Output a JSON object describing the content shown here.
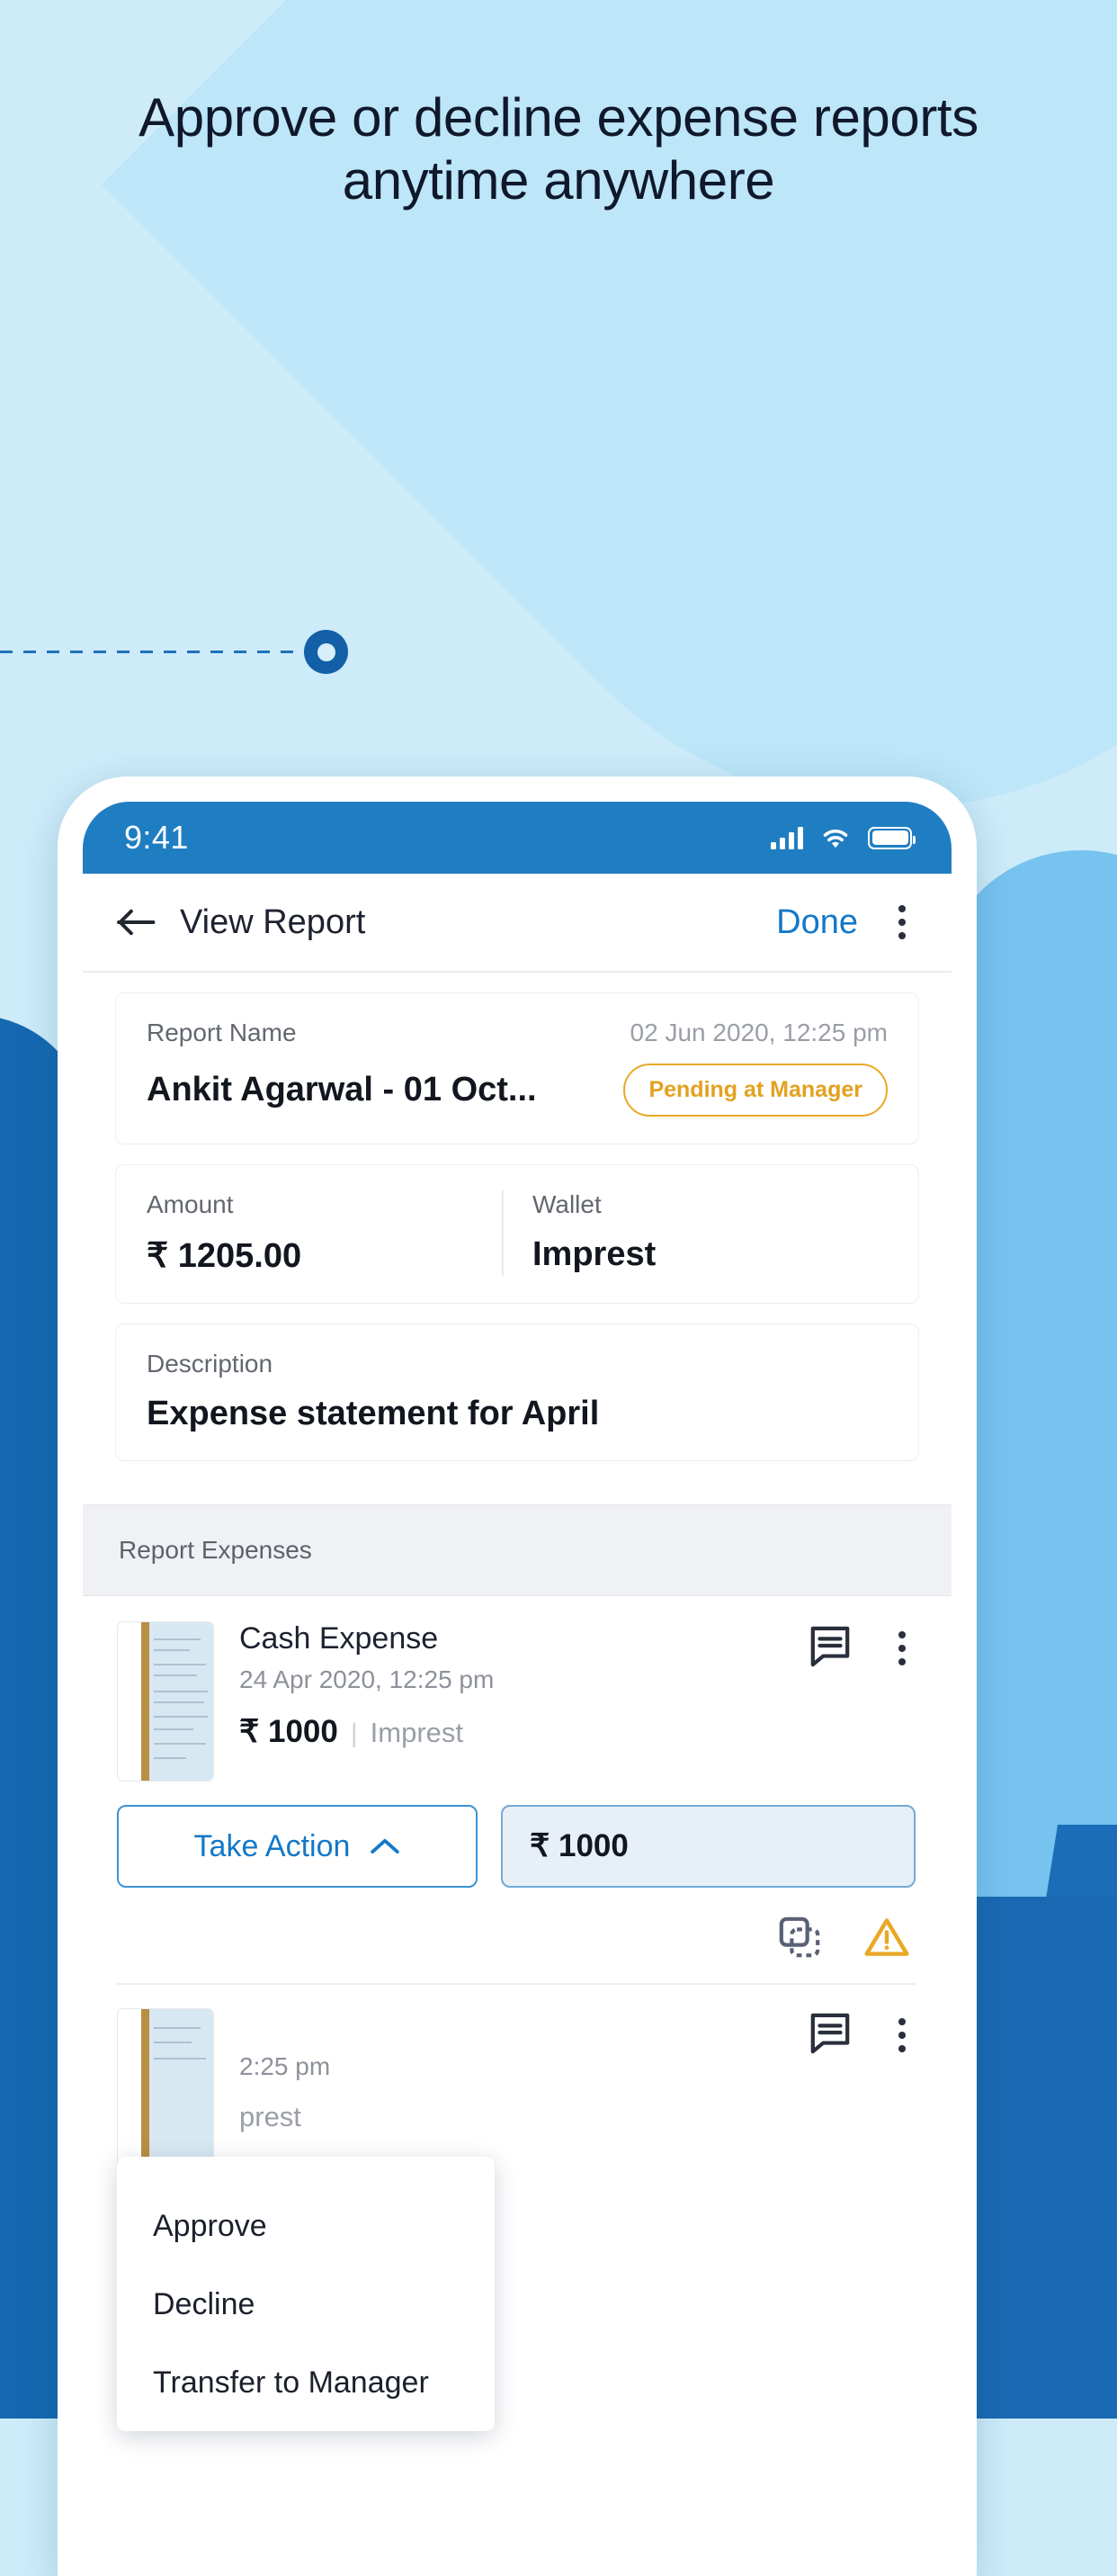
{
  "promo": {
    "headline": "Approve or decline expense reports anytime anywhere",
    "accent_color": "#1568b0",
    "background_color": "#cdebf9"
  },
  "phone": {
    "status_bar": {
      "time": "9:41",
      "icons": [
        "signal-icon",
        "wifi-icon",
        "battery-icon"
      ],
      "background_color": "#1f7ec2"
    },
    "app_bar": {
      "back_icon": "arrow-left-icon",
      "title": "View Report",
      "done_label": "Done",
      "overflow_icon": "kebab-menu-icon",
      "link_color": "#1378c8"
    },
    "report": {
      "name_label": "Report Name",
      "timestamp": "02 Jun 2020, 12:25 pm",
      "name_value": "Ankit Agarwal - 01 Oct...",
      "status_badge": "Pending at Manager",
      "status_color": "#e3a11f",
      "amount_label": "Amount",
      "amount_value": "₹ 1205.00",
      "wallet_label": "Wallet",
      "wallet_value": "Imprest",
      "description_label": "Description",
      "description_value": "Expense statement for April"
    },
    "expenses_section": {
      "header": "Report Expenses",
      "items": [
        {
          "title": "Cash Expense",
          "date": "24 Apr 2020, 12:25 pm",
          "amount": "₹ 1000",
          "separator": "|",
          "wallet": "Imprest",
          "comment_icon": "comment-icon",
          "overflow_icon": "kebab-menu-icon"
        },
        {
          "date": "2:25 pm",
          "wallet": "prest",
          "comment_icon": "comment-icon",
          "overflow_icon": "kebab-menu-icon"
        }
      ]
    },
    "action_bar": {
      "take_action_label": "Take Action",
      "chevron_icon": "chevron-up-icon",
      "amount_value": "₹ 1000",
      "duplicate_icon": "duplicate-icon",
      "warning_icon": "warning-triangle-icon",
      "warning_color": "#e9a826"
    },
    "dropdown": {
      "options": [
        "Approve",
        "Decline",
        "Transfer to Manager"
      ]
    }
  }
}
